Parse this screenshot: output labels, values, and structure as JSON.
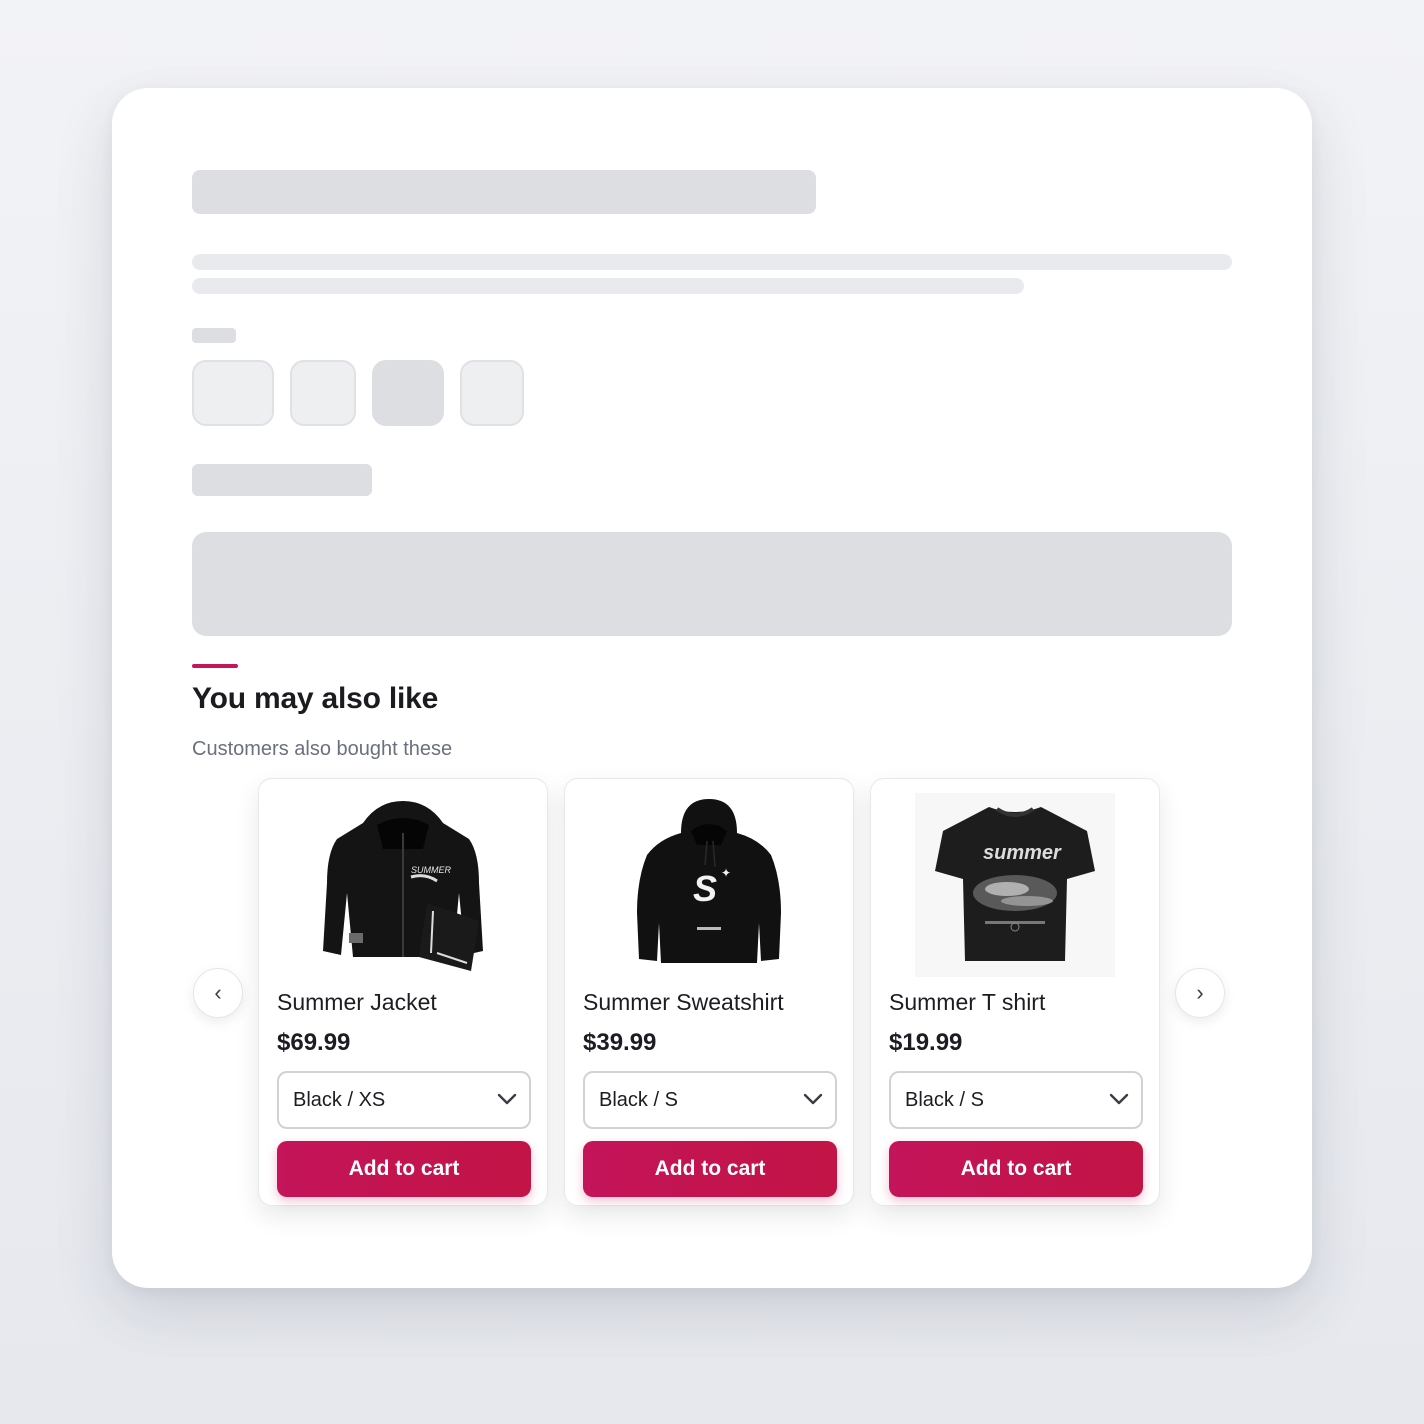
{
  "recommendations": {
    "title": "You may also like",
    "subtitle": "Customers also bought these",
    "prev_icon": "‹",
    "next_icon": "›",
    "accent_color": "#c2185b",
    "products": [
      {
        "name": "Summer Jacket",
        "price": "$69.99",
        "variant": "Black / XS",
        "button": "Add to cart",
        "image": "black-jacket"
      },
      {
        "name": "Summer Sweatshirt",
        "price": "$39.99",
        "variant": "Black / S",
        "button": "Add to cart",
        "image": "black-hoodie"
      },
      {
        "name": "Summer T shirt",
        "price": "$19.99",
        "variant": "Black / S",
        "button": "Add to cart",
        "image": "black-tshirt"
      }
    ]
  },
  "product_art": {
    "jacket_logo": "SUMMER",
    "hoodie_logo": "S",
    "tshirt_logo": "summer"
  }
}
